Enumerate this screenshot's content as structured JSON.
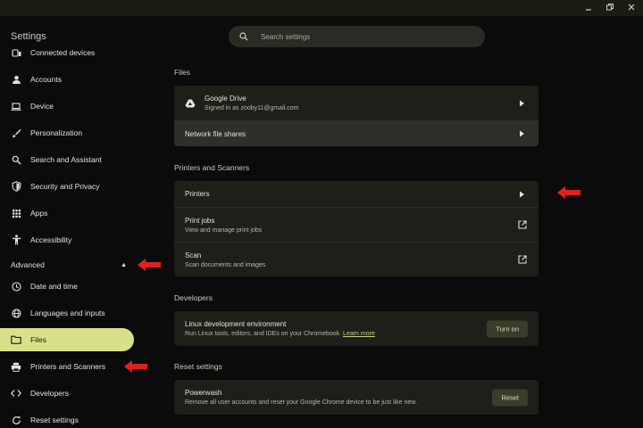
{
  "app": {
    "title": "Settings"
  },
  "search": {
    "placeholder": "Search settings"
  },
  "colors": {
    "accent": "#d8e08a",
    "arrow": "#e0201b",
    "card": "#1e1f18",
    "background": "#0b0b0b"
  },
  "sidebar": {
    "items": [
      {
        "label": "Connected devices",
        "icon": "devices-icon"
      },
      {
        "label": "Accounts",
        "icon": "person-icon"
      },
      {
        "label": "Device",
        "icon": "laptop-icon"
      },
      {
        "label": "Personalization",
        "icon": "brush-icon"
      },
      {
        "label": "Search and Assistant",
        "icon": "search-icon"
      },
      {
        "label": "Security and Privacy",
        "icon": "shield-icon"
      },
      {
        "label": "Apps",
        "icon": "apps-grid-icon"
      },
      {
        "label": "Accessibility",
        "icon": "accessibility-icon"
      }
    ],
    "advanced_label": "Advanced",
    "advanced_items": [
      {
        "label": "Date and time",
        "icon": "clock-icon"
      },
      {
        "label": "Languages and inputs",
        "icon": "globe-icon"
      },
      {
        "label": "Files",
        "icon": "folder-icon",
        "active": true
      },
      {
        "label": "Printers and Scanners",
        "icon": "printer-icon"
      },
      {
        "label": "Developers",
        "icon": "code-icon"
      },
      {
        "label": "Reset settings",
        "icon": "reset-icon"
      }
    ]
  },
  "main": {
    "files": {
      "title": "Files",
      "google_drive": {
        "title": "Google Drive",
        "subtitle": "Signed in as zooby11@gmail.com"
      },
      "network_shares": "Network file shares"
    },
    "printers": {
      "title": "Printers and Scanners",
      "printers": "Printers",
      "print_jobs": {
        "title": "Print jobs",
        "subtitle": "View and manage print jobs"
      },
      "scan": {
        "title": "Scan",
        "subtitle": "Scan documents and images"
      }
    },
    "developers": {
      "title": "Developers",
      "linux": {
        "title": "Linux development environment",
        "subtitle": "Run Linux tools, editors, and IDEs on your Chromebook.",
        "link": "Learn more",
        "button": "Turn on"
      }
    },
    "reset": {
      "title": "Reset settings",
      "powerwash": {
        "title": "Powerwash",
        "subtitle": "Remove all user accounts and reset your Google Chrome device to be just like new.",
        "button": "Reset"
      }
    }
  }
}
